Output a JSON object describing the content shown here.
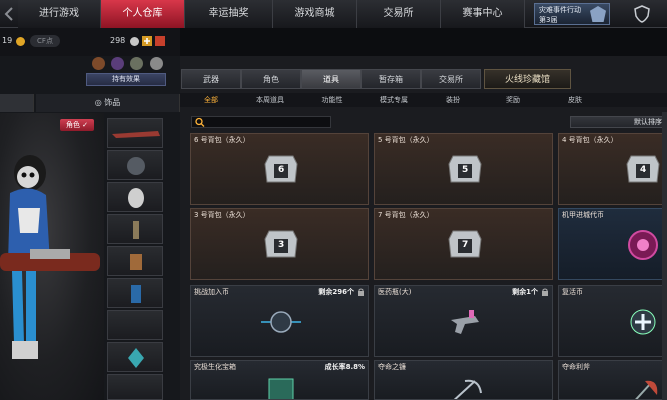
{
  "nav": {
    "tabs": [
      "进行游戏",
      "个人仓库",
      "幸运抽奖",
      "游戏商城",
      "交易所",
      "赛事中心"
    ],
    "active_tab": "个人仓库",
    "user_card": {
      "line1": "灾难事件行动",
      "line2": "第3届"
    }
  },
  "currency": {
    "gold": "19",
    "cf_label": "CF点",
    "gp": "298"
  },
  "left": {
    "effect_button": "持有效果",
    "subtabs": [
      "",
      "饰品"
    ],
    "role_chip": "角色 ✓"
  },
  "categories": [
    "武器",
    "角色",
    "道具",
    "暂存箱",
    "交易所",
    "火线珍藏馆"
  ],
  "active_category": "道具",
  "filters": [
    "全部",
    "本周道具",
    "功能性",
    "模式专属",
    "装扮",
    "奖励",
    "皮肤"
  ],
  "active_filter": "全部",
  "sort_label": "默认排序",
  "cards": [
    {
      "name": "6 号背包（永久）",
      "bag": "6",
      "type": "bag",
      "remain": ""
    },
    {
      "name": "5 号背包（永久）",
      "bag": "5",
      "type": "bag",
      "remain": ""
    },
    {
      "name": "4 号背包（永久）",
      "bag": "4",
      "type": "bag",
      "remain": ""
    },
    {
      "name": "3 号背包（永久）",
      "bag": "3",
      "type": "bag",
      "remain": ""
    },
    {
      "name": "7 号背包（永久）",
      "bag": "7",
      "type": "bag",
      "remain": ""
    },
    {
      "name": "机甲进城代币",
      "bag": "",
      "type": "token",
      "remain": ""
    },
    {
      "name": "挑战加入币",
      "bag": "",
      "type": "coin",
      "remain": "剩余296个"
    },
    {
      "name": "医药瓶(大)",
      "bag": "",
      "type": "gun",
      "remain": "剩余1个"
    },
    {
      "name": "复活币",
      "bag": "",
      "type": "cross",
      "remain": ""
    },
    {
      "name": "究极生化宝箱",
      "bag": "",
      "type": "box",
      "remain": "成长率8.8%"
    },
    {
      "name": "夺命之镰",
      "bag": "",
      "type": "scythe",
      "remain": ""
    },
    {
      "name": "夺命利斧",
      "bag": "",
      "type": "axe",
      "remain": ""
    }
  ],
  "colors": {
    "accent_red": "#c92a3d",
    "gold": "#ffb43a"
  }
}
